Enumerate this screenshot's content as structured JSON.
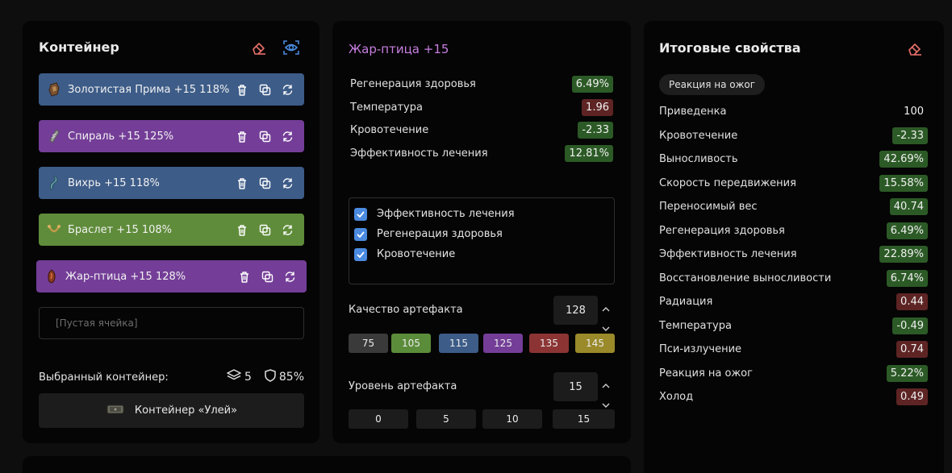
{
  "container_panel": {
    "title": "Контейнер",
    "slots": [
      {
        "label": "Золотистая Прима +15 118%",
        "icon": "golden-prima-icon",
        "color": "#3d5c88"
      },
      {
        "label": "Спираль +15 125%",
        "icon": "spiral-icon",
        "color": "#743e98"
      },
      {
        "label": "Вихрь +15 118%",
        "icon": "vortex-icon",
        "color": "#3d5c88"
      },
      {
        "label": "Браслет +15 108%",
        "icon": "bracelet-icon",
        "color": "#5f8c3a"
      },
      {
        "label": "Жар-птица +15 128%",
        "icon": "firebird-icon",
        "color": "#743e98"
      }
    ],
    "empty_slot": "[Пустая ячейка]",
    "selected_label": "Выбранный контейнер:",
    "slots_count": "5",
    "protection": "85%",
    "container_name": "Контейнер «Улей»"
  },
  "artifact_panel": {
    "title": "Жар-птица +15",
    "title_color": "#c77ee0",
    "stats": [
      {
        "name": "Регенерация здоровья",
        "value": "6.49%",
        "kind": "pos"
      },
      {
        "name": "Температура",
        "value": "1.96",
        "kind": "neg"
      },
      {
        "name": "Кровотечение",
        "value": "-2.33",
        "kind": "pos"
      },
      {
        "name": "Эффективность лечения",
        "value": "12.81%",
        "kind": "pos"
      }
    ],
    "checks": [
      "Эффективность лечения",
      "Регенерация здоровья",
      "Кровотечение"
    ],
    "quality_label": "Качество артефакта",
    "quality_value": "128",
    "quality_presets": [
      {
        "label": "75",
        "color": "#3a3a3a"
      },
      {
        "label": "105",
        "color": "#5b8c3a"
      },
      {
        "label": "115",
        "color": "#3d5c88"
      },
      {
        "label": "125",
        "color": "#743e98"
      },
      {
        "label": "135",
        "color": "#8c3434"
      },
      {
        "label": "145",
        "color": "#9a8a2a"
      }
    ],
    "level_label": "Уровень артефакта",
    "level_value": "15",
    "level_presets": [
      "0",
      "5",
      "10",
      "15"
    ]
  },
  "totals_panel": {
    "title": "Итоговые свойства",
    "tag": "Реакция на ожог",
    "stats": [
      {
        "name": "Приведенка",
        "value": "100",
        "kind": "plain"
      },
      {
        "name": "Кровотечение",
        "value": "-2.33",
        "kind": "pos"
      },
      {
        "name": "Выносливость",
        "value": "42.69%",
        "kind": "pos"
      },
      {
        "name": "Скорость передвижения",
        "value": "15.58%",
        "kind": "pos"
      },
      {
        "name": "Переносимый вес",
        "value": "40.74",
        "kind": "pos"
      },
      {
        "name": "Регенерация здоровья",
        "value": "6.49%",
        "kind": "pos"
      },
      {
        "name": "Эффективность лечения",
        "value": "22.89%",
        "kind": "pos"
      },
      {
        "name": "Восстановление выносливости",
        "value": "6.74%",
        "kind": "pos"
      },
      {
        "name": "Радиация",
        "value": "0.44",
        "kind": "neg"
      },
      {
        "name": "Температура",
        "value": "-0.49",
        "kind": "pos"
      },
      {
        "name": "Пси-излучение",
        "value": "0.74",
        "kind": "neg"
      },
      {
        "name": "Реакция на ожог",
        "value": "5.22%",
        "kind": "pos"
      },
      {
        "name": "Холод",
        "value": "0.49",
        "kind": "neg"
      }
    ]
  },
  "colors": {
    "accent_blue": "#4a8be0",
    "danger": "#e8706a",
    "positive_bg": "#2c5a26",
    "negative_bg": "#5e2424"
  }
}
